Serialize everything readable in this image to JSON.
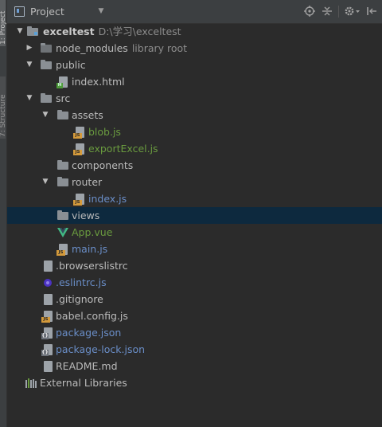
{
  "side_strip": {
    "project_tab": "1: Project",
    "structure_tab": "7: Structure"
  },
  "header": {
    "title": "Project",
    "dropdown_icon": "caret-down-icon",
    "tools": [
      "locate-icon",
      "collapse-icon",
      "settings-icon",
      "hide-icon"
    ]
  },
  "colors": {
    "default_text": "#bbbbbb",
    "modified_green": "#6a9b3f",
    "changed_blue": "#6a8ec8",
    "selected_row": "#0d293e",
    "js_badge": "#d49a3b"
  },
  "tree": [
    {
      "label": "exceltest",
      "extra": "D:\\学习\\exceltest",
      "type": "folder-module",
      "expanded": true,
      "level": 0,
      "bold": true
    },
    {
      "label": "node_modules",
      "extra": "library root",
      "type": "folder-lib",
      "expanded": false,
      "level": 1
    },
    {
      "label": "public",
      "extra": "",
      "type": "folder",
      "expanded": true,
      "level": 1
    },
    {
      "label": "index.html",
      "extra": "",
      "type": "file-html",
      "level": 2
    },
    {
      "label": "src",
      "extra": "",
      "type": "folder",
      "expanded": true,
      "level": 1
    },
    {
      "label": "assets",
      "extra": "",
      "type": "folder",
      "expanded": true,
      "level": 2
    },
    {
      "label": "blob.js",
      "extra": "",
      "type": "file-js",
      "level": 3,
      "color": "green"
    },
    {
      "label": "exportExcel.js",
      "extra": "",
      "type": "file-js",
      "level": 3,
      "color": "green"
    },
    {
      "label": "components",
      "extra": "",
      "type": "folder",
      "level": 2
    },
    {
      "label": "router",
      "extra": "",
      "type": "folder",
      "expanded": true,
      "level": 2
    },
    {
      "label": "index.js",
      "extra": "",
      "type": "file-js",
      "level": 3,
      "color": "blue"
    },
    {
      "label": "views",
      "extra": "",
      "type": "folder",
      "level": 2,
      "selected": true
    },
    {
      "label": "App.vue",
      "extra": "",
      "type": "file-vue",
      "level": 2,
      "color": "green"
    },
    {
      "label": "main.js",
      "extra": "",
      "type": "file-js",
      "level": 2,
      "color": "blue"
    },
    {
      "label": ".browserslistrc",
      "extra": "",
      "type": "file-text",
      "level": 1
    },
    {
      "label": ".eslintrc.js",
      "extra": "",
      "type": "file-eslint",
      "level": 1,
      "color": "blue"
    },
    {
      "label": ".gitignore",
      "extra": "",
      "type": "file-text",
      "level": 1
    },
    {
      "label": "babel.config.js",
      "extra": "",
      "type": "file-js",
      "level": 1
    },
    {
      "label": "package.json",
      "extra": "",
      "type": "file-json",
      "level": 1,
      "color": "blue"
    },
    {
      "label": "package-lock.json",
      "extra": "",
      "type": "file-json",
      "level": 1,
      "color": "blue"
    },
    {
      "label": "README.md",
      "extra": "",
      "type": "file-text",
      "level": 1
    },
    {
      "label": "External Libraries",
      "extra": "",
      "type": "libraries",
      "level": 0
    }
  ]
}
